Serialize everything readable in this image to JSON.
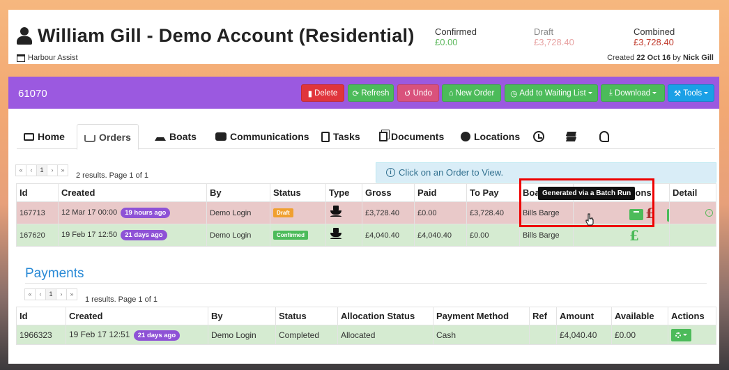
{
  "header": {
    "title": "William Gill - Demo Account (Residential)",
    "subtitle": "Harbour Assist",
    "confirmed_label": "Confirmed",
    "confirmed_value": "£0.00",
    "draft_label": "Draft",
    "draft_value": "£3,728.40",
    "combined_label": "Combined",
    "combined_value": "£3,728.40",
    "created_prefix": "Created",
    "created_date": "22 Oct 16",
    "created_by_word": "by",
    "created_by": "Nick Gill"
  },
  "toolbar": {
    "order_id": "61070",
    "delete": "Delete",
    "refresh": "Refresh",
    "undo": "Undo",
    "new_order": "New Order",
    "waiting_list": "Add to Waiting List",
    "download": "Download",
    "tools": "Tools"
  },
  "tabs": {
    "home": "Home",
    "orders": "Orders",
    "boats": "Boats",
    "communications": "Communications",
    "tasks": "Tasks",
    "documents": "Documents",
    "locations": "Locations"
  },
  "pager": {
    "first": "«",
    "prev": "‹",
    "page": "1",
    "next": "›",
    "last": "»"
  },
  "orders": {
    "results": "2 results. Page 1 of 1",
    "info": "Click on an Order to View.",
    "columns": [
      "Id",
      "Created",
      "By",
      "Status",
      "Type",
      "Gross",
      "Paid",
      "To Pay",
      "Boat",
      "Actions",
      "Detail"
    ],
    "rows": [
      {
        "id": "167713",
        "created": "12 Mar 17 00:00",
        "ago": "19 hours ago",
        "by": "Demo Login",
        "status": "Draft",
        "gross": "£3,728.40",
        "paid": "£0.00",
        "to_pay": "£3,728.40",
        "boat": "Bills Barge"
      },
      {
        "id": "167620",
        "created": "19 Feb 17 12:50",
        "ago": "21 days ago",
        "by": "Demo Login",
        "status": "Confirmed",
        "gross": "£4,040.40",
        "paid": "£4,040.40",
        "to_pay": "£0.00",
        "boat": "Bills Barge"
      }
    ],
    "tooltip": "Generated via a Batch Run",
    "pound_symbol": "£"
  },
  "payments": {
    "title": "Payments",
    "results": "1 results. Page 1 of 1",
    "columns": [
      "Id",
      "Created",
      "By",
      "Status",
      "Allocation Status",
      "Payment Method",
      "Ref",
      "Amount",
      "Available",
      "Actions"
    ],
    "rows": [
      {
        "id": "1966323",
        "created": "19 Feb 17 12:51",
        "ago": "21 days ago",
        "by": "Demo Login",
        "status": "Completed",
        "allocation": "Allocated",
        "method": "Cash",
        "ref": "",
        "amount": "£4,040.40",
        "available": "£0.00"
      }
    ]
  },
  "colors": {
    "accent_purple": "#9b59e0",
    "danger": "#e0353b",
    "success": "#4cbb5a",
    "info": "#1aa0e6",
    "link": "#2a8ad6"
  },
  "icons": [
    "user-icon",
    "calendar-icon",
    "home-icon",
    "basket-icon",
    "boat-icon",
    "chat-icon",
    "clipboard-icon",
    "documents-icon",
    "globe-icon",
    "clock-icon",
    "layers-icon",
    "head-icon",
    "info-icon",
    "gear-icon",
    "pound-icon",
    "batch-icon",
    "detail-icon"
  ]
}
